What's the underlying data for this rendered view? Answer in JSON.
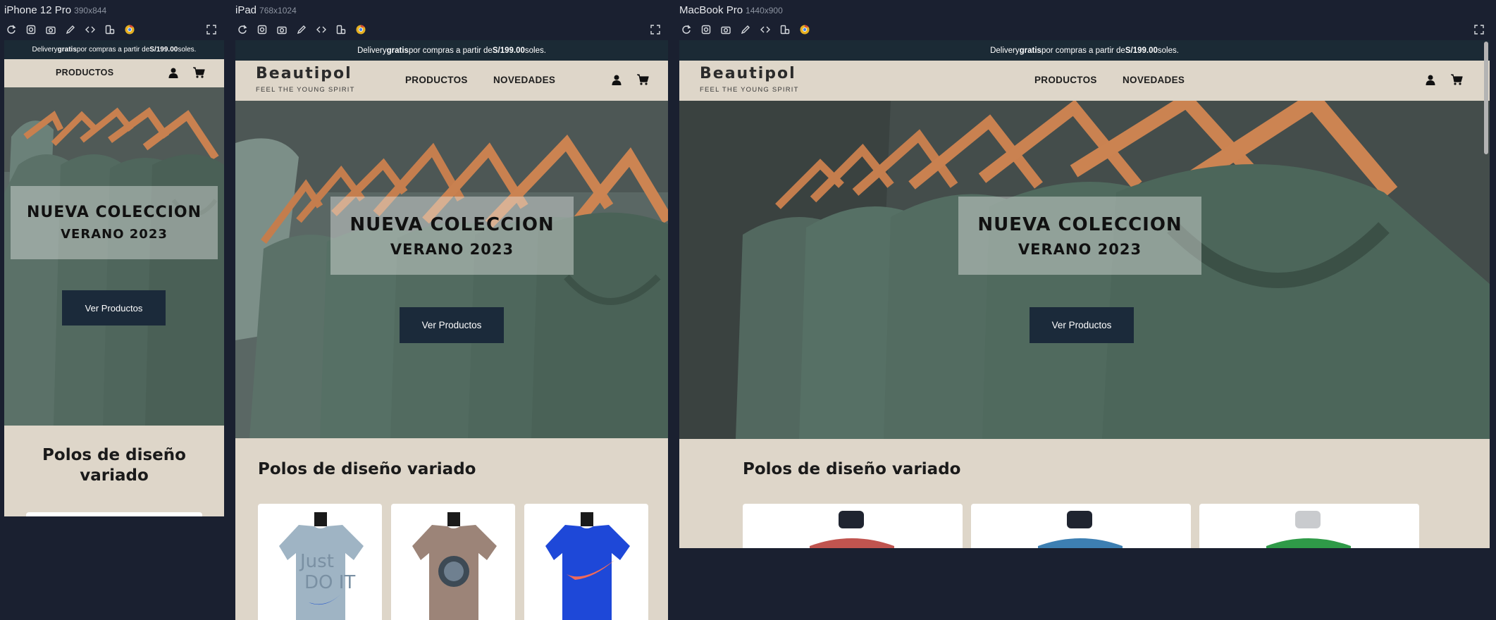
{
  "devices": {
    "iphone": {
      "name": "iPhone 12 Pro",
      "dims": "390x844"
    },
    "ipad": {
      "name": "iPad",
      "dims": "768x1024"
    },
    "macbook": {
      "name": "MacBook Pro",
      "dims": "1440x900"
    }
  },
  "toolbar_icons": [
    "refresh-icon",
    "screenshot-icon",
    "camera-icon",
    "pen-icon",
    "code-icon",
    "rotate-icon",
    "chrome-icon"
  ],
  "site": {
    "topbar": {
      "pre": "Delivery ",
      "bold1": "gratis",
      "mid": " por compras a partir de ",
      "bold2": "S/199.00",
      "post": " soles."
    },
    "brand": {
      "name": "Beautipol",
      "tagline": "FEEL THE YOUNG SPIRIT"
    },
    "nav": {
      "products": "PRODUCTOS",
      "news": "NOVEDADES"
    },
    "hero": {
      "title": "NUEVA COLECCION",
      "subtitle": "VERANO 2023",
      "button": "Ver Productos"
    },
    "section_title": "Polos de diseño variado",
    "mobile_section_line1": "Polos de diseño",
    "mobile_section_line2": "variado"
  },
  "colors": {
    "background": "#1a2030",
    "topbar": "#1b2a35",
    "navbar": "#ded6c9",
    "button": "#1b2a3a",
    "shirt": "#4f6b5e"
  }
}
